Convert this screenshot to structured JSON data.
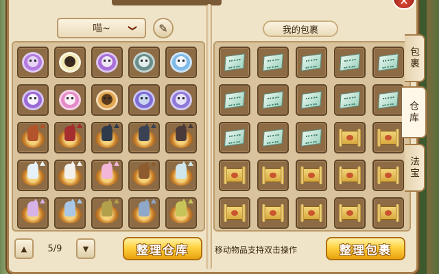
{
  "header": {
    "category_selected": "喵~",
    "category_chevron": "❯",
    "pen_icon": "✎",
    "bag_title": "我的包裹",
    "close_icon": "✕"
  },
  "tabs": [
    {
      "label": "包裹",
      "active": false
    },
    {
      "label": "仓库",
      "active": true
    },
    {
      "label": "法宝",
      "active": false
    }
  ],
  "warehouse": {
    "items": [
      {
        "kind": "bed",
        "pod": "#b37be0",
        "pet": "#e7d3f5"
      },
      {
        "kind": "bed",
        "pod": "#f2e8b4",
        "pet": "#3d2a1d"
      },
      {
        "kind": "bed",
        "pod": "#a86fd8",
        "pet": "#efe6f8"
      },
      {
        "kind": "bed",
        "pod": "#6a8f8a",
        "pet": "#e4eeee"
      },
      {
        "kind": "bed",
        "pod": "#7fb9e8",
        "pet": "#f0f6fb"
      },
      {
        "kind": "bed",
        "pod": "#9a6ad6",
        "pet": "#f7f2fb"
      },
      {
        "kind": "bed",
        "pod": "#e58ac6",
        "pet": "#fbeef7"
      },
      {
        "kind": "bed",
        "pod": "#e3a64f",
        "pet": "#5a3b1d"
      },
      {
        "kind": "bed",
        "pod": "#7e6cd6",
        "pet": "#c9d6f1"
      },
      {
        "kind": "bed",
        "pod": "#8f7ad9",
        "pet": "#e9e3f8"
      },
      {
        "kind": "basket",
        "pet": "#b3542a"
      },
      {
        "kind": "basket",
        "pet": "#a52e2e"
      },
      {
        "kind": "basket",
        "pet": "#2f3a4a"
      },
      {
        "kind": "basket",
        "pet": "#3b4254"
      },
      {
        "kind": "basket",
        "pet": "#4a3a3a"
      },
      {
        "kind": "basket",
        "pet": "#e7f2f8"
      },
      {
        "kind": "basket",
        "pet": "#f4f1ec"
      },
      {
        "kind": "basket",
        "pet": "#f3b5d8"
      },
      {
        "kind": "basket",
        "pet": "#8c5b2e"
      },
      {
        "kind": "basket",
        "pet": "#cfe6ec"
      },
      {
        "kind": "basket",
        "pet": "#d7b2e6"
      },
      {
        "kind": "basket",
        "pet": "#a9c8e8"
      },
      {
        "kind": "basket",
        "pet": "#b3a04a"
      },
      {
        "kind": "basket",
        "pet": "#8fa7c8"
      },
      {
        "kind": "basket",
        "pet": "#c7c45a"
      }
    ],
    "page_current": "5/9",
    "prev_icon": "▲",
    "next_icon": "▼",
    "tidy_label": "整理仓库"
  },
  "bag": {
    "items": [
      "map",
      "map",
      "map",
      "map",
      "map",
      "map",
      "map",
      "map",
      "map",
      "map",
      "map",
      "map",
      "map",
      "scroll",
      "scroll",
      "scroll",
      "scroll",
      "scroll",
      "scroll",
      "scroll",
      "scroll",
      "scroll",
      "scroll",
      "scroll",
      "scroll"
    ],
    "hint": "移动物品支持双击操作",
    "tidy_label": "整理包裹"
  }
}
